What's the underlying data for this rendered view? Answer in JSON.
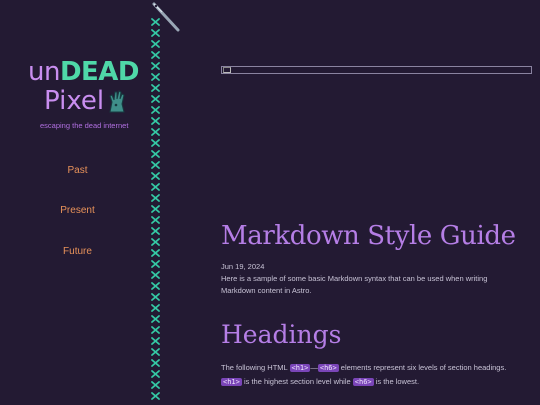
{
  "sidebar": {
    "logo": {
      "part1": "un",
      "part2": "DEAD",
      "part3": "Pixel"
    },
    "tagline": "escaping the dead internet",
    "nav": [
      {
        "label": "Past"
      },
      {
        "label": "Present"
      },
      {
        "label": "Future"
      }
    ]
  },
  "main": {
    "title": "Markdown Style Guide",
    "date": "Jun 19, 2024",
    "intro": "Here is a sample of some basic Markdown syntax that can be used when writing Markdown content in Astro.",
    "section_heading": "Headings",
    "paragraph": {
      "t1": "The following HTML ",
      "c1": "<h1>",
      "t2": "—",
      "c2": "<h6>",
      "t3": " elements represent six levels of section headings.",
      "c3": "<h1>",
      "t4": " is the highest section level while ",
      "c4": "<h6>",
      "t5": " is the lowest."
    }
  },
  "colors": {
    "background": "#231a33",
    "accent_purple": "#b57ee6",
    "accent_green": "#4fd8a8",
    "nav_orange": "#e8925a",
    "code_bg": "#7a45b8"
  }
}
